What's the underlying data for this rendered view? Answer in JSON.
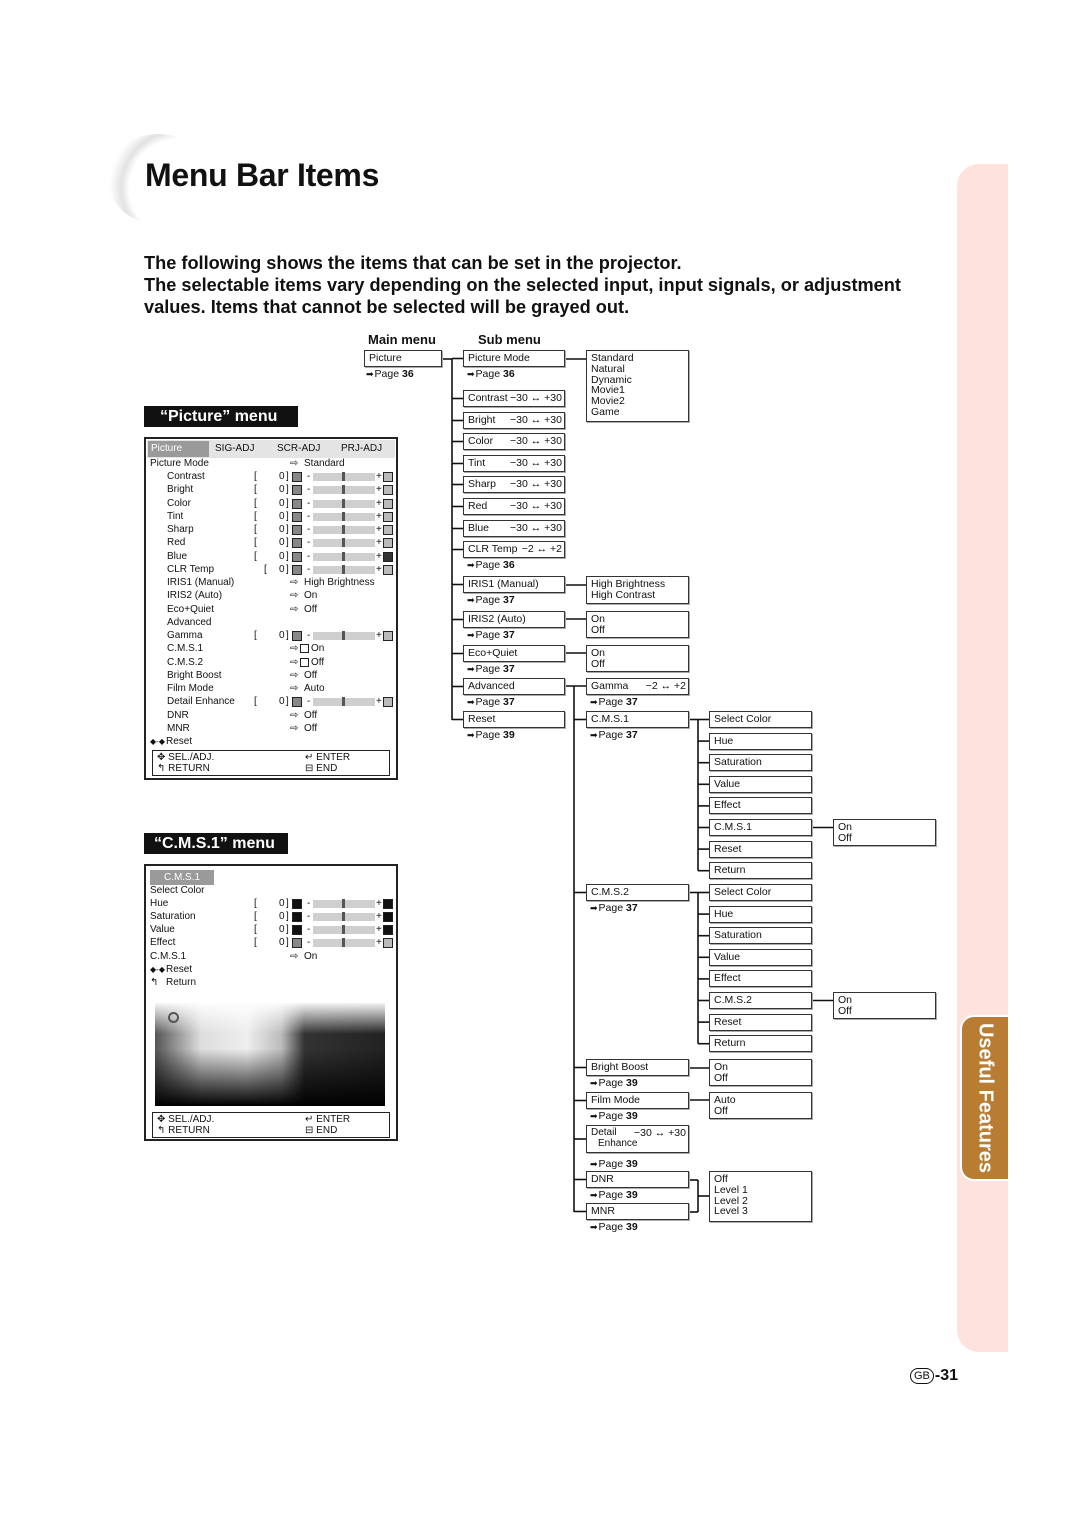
{
  "page": {
    "title": "Menu Bar Items",
    "intro_lines": [
      "The following shows the items that can be set in the projector.",
      "The selectable items vary depending on the selected input, input signals, or adjustment",
      "values. Items that cannot be selected will be grayed out."
    ],
    "side_tab": "Useful Features",
    "page_badge": "GB",
    "page_number": "-31",
    "colors": {
      "side_pink": "#fde3dc",
      "side_tab": "#b87d32"
    }
  },
  "picture_menu": {
    "heading": "“Picture” menu",
    "tabs": [
      "Picture",
      "SIG-ADJ",
      "SCR-ADJ",
      "PRJ-ADJ"
    ],
    "rows": [
      {
        "label": "Picture Mode",
        "sub": false,
        "option": "Standard"
      },
      {
        "label": "Contrast",
        "sub": true,
        "value": "0",
        "icon": "contrast-icon"
      },
      {
        "label": "Bright",
        "sub": true,
        "value": "0",
        "icon": "bright-icon"
      },
      {
        "label": "Color",
        "sub": true,
        "value": "0",
        "icon": "color-icon"
      },
      {
        "label": "Tint",
        "sub": true,
        "value": "0",
        "icon": "tint-icon"
      },
      {
        "label": "Sharp",
        "sub": true,
        "value": "0",
        "icon": "sharp-icon"
      },
      {
        "label": "Red",
        "sub": true,
        "value": "0",
        "icon": "red-icon"
      },
      {
        "label": "Blue",
        "sub": true,
        "value": "0",
        "icon": "blue-icon"
      },
      {
        "label": "CLR Temp",
        "sub": true,
        "value": "0",
        "icon": "clr-temp-icon"
      },
      {
        "label": "IRIS1 (Manual)",
        "sub": true,
        "option": "High Brightness"
      },
      {
        "label": "IRIS2 (Auto)",
        "sub": true,
        "option": "On"
      },
      {
        "label": "Eco+Quiet",
        "sub": true,
        "option": "Off"
      },
      {
        "label": "Advanced",
        "sub": true
      },
      {
        "label": "Gamma",
        "sub": true,
        "value": "0",
        "icon": "gamma-icon"
      },
      {
        "label": "C.M.S.1",
        "sub": true,
        "option": "On",
        "checkbox": true
      },
      {
        "label": "C.M.S.2",
        "sub": true,
        "option": "Off",
        "checkbox": true
      },
      {
        "label": "Bright Boost",
        "sub": true,
        "option": "Off"
      },
      {
        "label": "Film Mode",
        "sub": true,
        "option": "Auto"
      },
      {
        "label": "Detail Enhance",
        "sub": true,
        "value": "0",
        "icon": "detail-enhance-icon"
      },
      {
        "label": "DNR",
        "sub": true,
        "option": "Off"
      },
      {
        "label": "MNR",
        "sub": true,
        "option": "Off"
      },
      {
        "label": "Reset",
        "sub": false,
        "reset": true
      }
    ],
    "footer": {
      "sel": "SEL./ADJ.",
      "return": "RETURN",
      "enter": "ENTER",
      "end": "END"
    }
  },
  "cms1_menu": {
    "heading": "“C.M.S.1” menu",
    "tab": "C.M.S.1",
    "rows": [
      {
        "label": "Select Color"
      },
      {
        "label": "Hue",
        "value": "0",
        "icon": "hue-icon"
      },
      {
        "label": "Saturation",
        "value": "0",
        "icon": "saturation-icon"
      },
      {
        "label": "Value",
        "value": "0",
        "icon": "value-icon"
      },
      {
        "label": "Effect",
        "value": "0",
        "icon": "effect-icon"
      },
      {
        "label": "C.M.S.1",
        "option": "On"
      },
      {
        "label": "Reset",
        "reset": true
      },
      {
        "label": "Return",
        "return": true
      }
    ],
    "footer": {
      "sel": "SEL./ADJ.",
      "return": "RETURN",
      "enter": "ENTER",
      "end": "END"
    }
  },
  "diagram": {
    "main_menu_heading": "Main menu",
    "sub_menu_heading": "Sub menu",
    "page_prefix": "Page",
    "picture": {
      "label": "Picture",
      "page": "36"
    },
    "sub": [
      {
        "label": "Picture Mode",
        "page": "36"
      },
      {
        "label": "Contrast",
        "range": "−30 ↔ +30"
      },
      {
        "label": "Bright",
        "range": "−30 ↔ +30"
      },
      {
        "label": "Color",
        "range": "−30 ↔ +30"
      },
      {
        "label": "Tint",
        "range": "−30 ↔ +30"
      },
      {
        "label": "Sharp",
        "range": "−30 ↔ +30"
      },
      {
        "label": "Red",
        "range": "−30 ↔ +30"
      },
      {
        "label": "Blue",
        "range": "−30 ↔ +30"
      },
      {
        "label": "CLR Temp",
        "range": "−2 ↔ +2",
        "page": "36"
      },
      {
        "label": "IRIS1 (Manual)",
        "page": "37"
      },
      {
        "label": "IRIS2 (Auto)",
        "page": "37"
      },
      {
        "label": "Eco+Quiet",
        "page": "37"
      },
      {
        "label": "Advanced",
        "page": "37"
      },
      {
        "label": "Reset",
        "page": "39"
      }
    ],
    "advanced": [
      {
        "label": "Gamma",
        "range": "−2 ↔ +2",
        "page": "37"
      },
      {
        "label": "C.M.S.1",
        "page": "37"
      },
      {
        "label": "C.M.S.2",
        "page": "37"
      },
      {
        "label": "Bright Boost",
        "page": "39"
      },
      {
        "label": "Film Mode",
        "page": "39"
      },
      {
        "label": "Detail",
        "label2": "Enhance",
        "range": "−30 ↔ +30",
        "page": "39"
      },
      {
        "label": "DNR",
        "page": "39"
      },
      {
        "label": "MNR",
        "page": "39"
      }
    ],
    "cms1_items": [
      "Select Color",
      "Hue",
      "Saturation",
      "Value",
      "Effect",
      "C.M.S.1",
      "Reset",
      "Return"
    ],
    "cms2_items": [
      "Select Color",
      "Hue",
      "Saturation",
      "Value",
      "Effect",
      "C.M.S.2",
      "Reset",
      "Return"
    ],
    "options": {
      "picture_mode": [
        "Standard",
        "Natural",
        "Dynamic",
        "Movie1",
        "Movie2",
        "Game"
      ],
      "iris1": [
        "High Brightness",
        "High Contrast"
      ],
      "iris2": [
        "On",
        "Off"
      ],
      "eco_quiet": [
        "On",
        "Off"
      ],
      "cms1": [
        "On",
        "Off"
      ],
      "cms2": [
        "On",
        "Off"
      ],
      "bright_boost": [
        "On",
        "Off"
      ],
      "film_mode": [
        "Auto",
        "Off"
      ],
      "dnr_mnr": [
        "Off",
        "Level 1",
        "Level 2",
        "Level 3"
      ]
    }
  }
}
